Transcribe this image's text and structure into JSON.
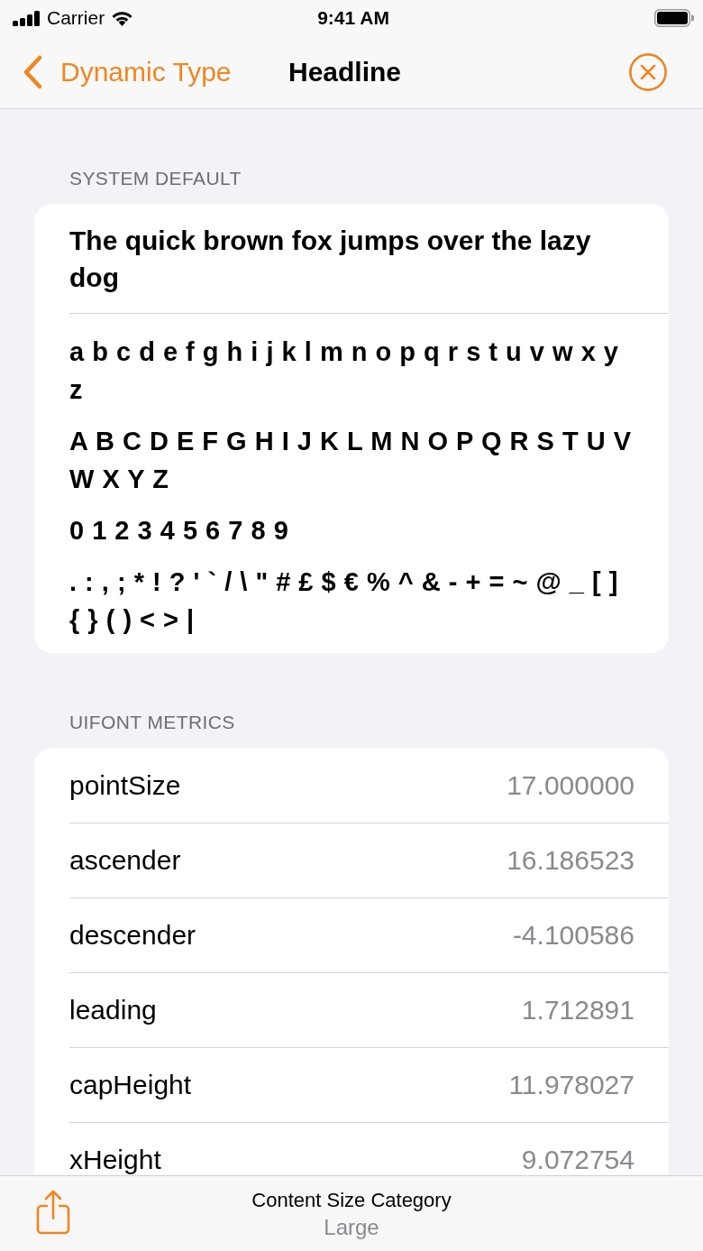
{
  "status_bar": {
    "carrier": "Carrier",
    "time": "9:41 AM"
  },
  "nav_bar": {
    "back_label": "Dynamic Type",
    "title": "Headline"
  },
  "sections": [
    {
      "kind": "sample",
      "header": "SYSTEM DEFAULT",
      "headline": "The quick brown fox jumps over the lazy dog",
      "character_sets": [
        "a b c d e f g h i j k l m n o p q r s t u v w x y z",
        "A B C D E F G H I J K L M N O P Q R S T U V W X Y Z",
        "0 1 2 3 4 5 6 7 8 9",
        ". : , ; * ! ? ' ` / \\ \" # £ $ € % ^ & - + = ~ @ _ [ ] { } ( ) < > |"
      ]
    },
    {
      "kind": "metrics",
      "header": "UIFONT METRICS",
      "rows": [
        {
          "label": "pointSize",
          "value": "17.000000"
        },
        {
          "label": "ascender",
          "value": "16.186523"
        },
        {
          "label": "descender",
          "value": "-4.100586"
        },
        {
          "label": "leading",
          "value": "1.712891"
        },
        {
          "label": "capHeight",
          "value": "11.978027"
        },
        {
          "label": "xHeight",
          "value": "9.072754"
        }
      ]
    }
  ],
  "toolbar": {
    "title": "Content Size Category",
    "value": "Large"
  }
}
